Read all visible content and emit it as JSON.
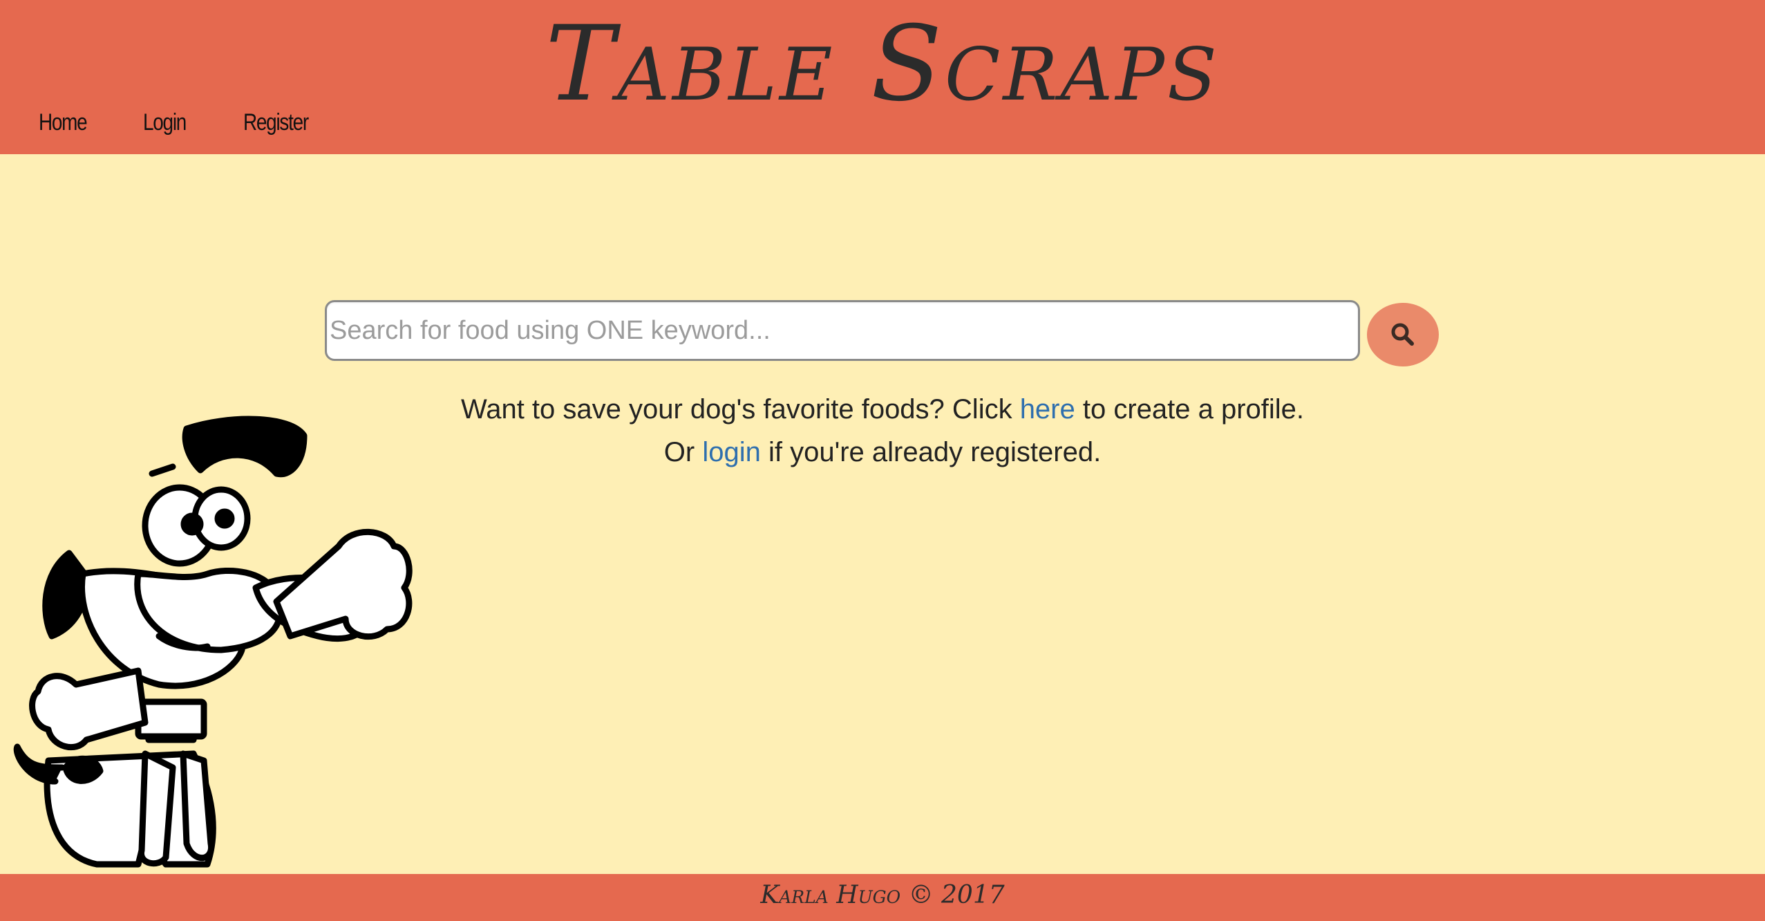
{
  "header": {
    "title": "Table Scraps",
    "nav": {
      "home": "Home",
      "login": "Login",
      "register": "Register"
    }
  },
  "search": {
    "placeholder": "Search for food using ONE keyword...",
    "value": "",
    "button_icon": "search-icon"
  },
  "info": {
    "line1_before": "Want to save your dog's favorite foods? Click ",
    "line1_link": "here",
    "line1_after": " to create a profile.",
    "line2_before": "Or ",
    "line2_link": "login",
    "line2_after": " if you're already registered."
  },
  "illustration": {
    "icon": "cartoon-dog-with-bone"
  },
  "footer": {
    "text": "Karla Hugo © 2017"
  },
  "colors": {
    "header_bg": "#e5694f",
    "page_bg": "#feefb5",
    "button_bg": "#ea8a6a",
    "link": "#2f6fae"
  }
}
